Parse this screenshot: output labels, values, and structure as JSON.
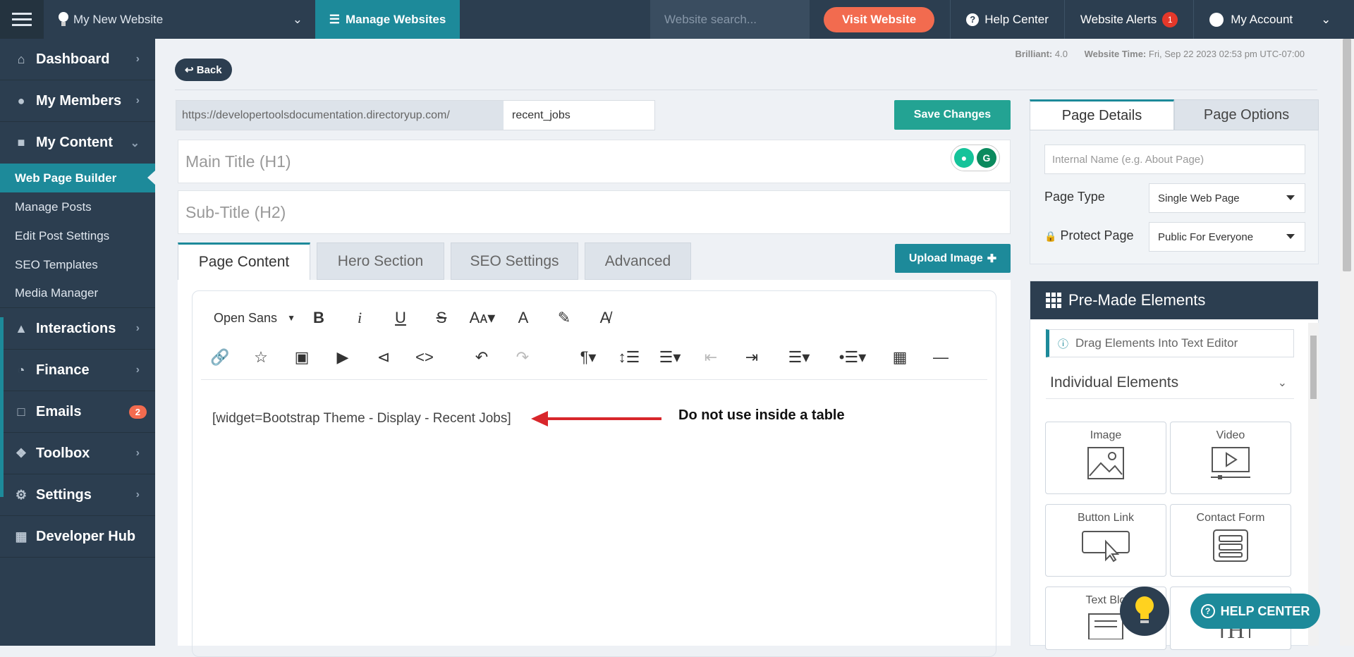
{
  "topbar": {
    "site_name": "My New Website",
    "manage_label": "Manage Websites",
    "search_placeholder": "Website search...",
    "visit_label": "Visit Website",
    "help_label": "Help Center",
    "alerts_label": "Website Alerts",
    "alerts_count": "1",
    "account_label": "My Account"
  },
  "sidebar": {
    "dashboard": "Dashboard",
    "members": "My Members",
    "content": "My Content",
    "sub": [
      "Web Page Builder",
      "Manage Posts",
      "Edit Post Settings",
      "SEO Templates",
      "Media Manager"
    ],
    "interactions": "Interactions",
    "finance": "Finance",
    "emails": "Emails",
    "emails_count": "2",
    "toolbox": "Toolbox",
    "settings": "Settings",
    "devhub": "Developer Hub"
  },
  "main": {
    "back_label": "Back",
    "brilliant_label": "Brilliant:",
    "brilliant_value": "4.0",
    "time_label": "Website Time:",
    "time_value": "Fri, Sep 22 2023 02:53 pm UTC-07:00",
    "url_prefix": "https://developertoolsdocumentation.directoryup.com/",
    "url_value": "recent_jobs",
    "save_label": "Save Changes",
    "title_placeholder": "Main Title (H1)",
    "subtitle_placeholder": "Sub-Title (H2)",
    "tabs": [
      "Page Content",
      "Hero Section",
      "SEO Settings",
      "Advanced"
    ],
    "upload_label": "Upload Image",
    "font_name": "Open Sans",
    "editor_content": "[widget=Bootstrap Theme - Display - Recent Jobs]",
    "note": "Do not use inside a table"
  },
  "right": {
    "tabs": [
      "Page Details",
      "Page Options"
    ],
    "internal_placeholder": "Internal Name (e.g. About Page)",
    "page_type_label": "Page Type",
    "page_type_value": "Single Web Page",
    "protect_label": "Protect Page",
    "protect_value": "Public For Everyone",
    "premade_title": "Pre-Made Elements",
    "drag_hint": "Drag Elements Into Text Editor",
    "individual": "Individual Elements",
    "cards": [
      "Image",
      "Video",
      "Button Link",
      "Contact Form",
      "Text Blo"
    ],
    "help_center": "HELP CENTER"
  },
  "colors": {
    "sidebar": "#2c3e50",
    "accent": "#1d8a9a",
    "orange": "#f26b4f",
    "green": "#23a393"
  }
}
